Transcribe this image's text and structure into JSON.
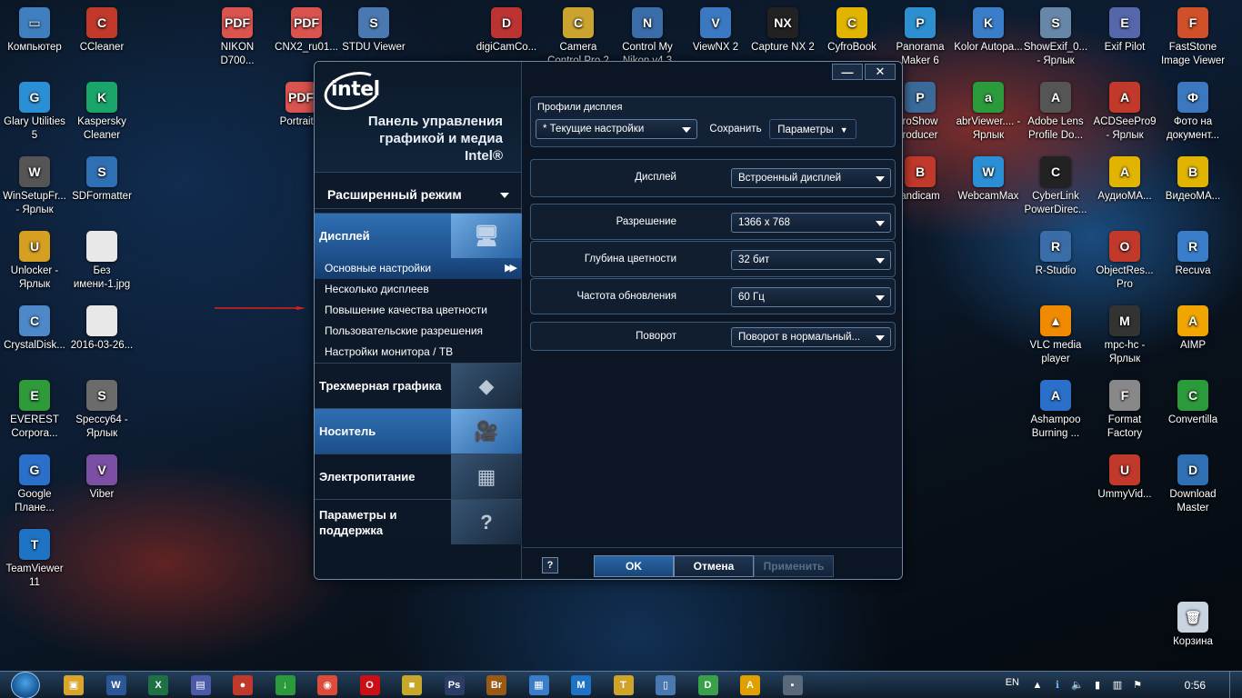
{
  "desktop_icons_left": [
    {
      "label": "Компьютер",
      "color": "#3f7fc0",
      "glyph": "▭"
    },
    {
      "label": "CCleaner",
      "color": "#c0392b",
      "glyph": "C"
    },
    {
      "label": "Glary Utilities 5",
      "color": "#2b8fd6",
      "glyph": "G"
    },
    {
      "label": "Kaspersky Cleaner",
      "color": "#1aa56b",
      "glyph": "K"
    },
    {
      "label": "WinSetupFr... - Ярлык",
      "color": "#555",
      "glyph": "W"
    },
    {
      "label": "SDFormatter",
      "color": "#2f6fb3",
      "glyph": "S"
    },
    {
      "label": "Unlocker - Ярлык",
      "color": "#d5a021",
      "glyph": "U"
    },
    {
      "label": "Без имени-1.jpg",
      "color": "#e8e8e8",
      "glyph": ""
    },
    {
      "label": "CrystalDisk...",
      "color": "#4d88c9",
      "glyph": "C"
    },
    {
      "label": "2016-03-26...",
      "color": "#e8e8e8",
      "glyph": ""
    },
    {
      "label": "EVEREST Corpora...",
      "color": "#2e9a3a",
      "glyph": "E"
    },
    {
      "label": "Speccy64 - Ярлык",
      "color": "#6b6b6b",
      "glyph": "S"
    },
    {
      "label": "Google Плане...",
      "color": "#2a6fc9",
      "glyph": "G"
    },
    {
      "label": "Viber",
      "color": "#7b4fa1",
      "glyph": "V"
    },
    {
      "label": "TeamViewer 11",
      "color": "#1f73c5",
      "glyph": "T"
    }
  ],
  "desktop_icons_top": [
    {
      "label": "NIKON D700...",
      "color": "#d9534f",
      "glyph": "PDF"
    },
    {
      "label": "CNX2_ru01...",
      "color": "#d9534f",
      "glyph": "PDF"
    },
    {
      "label": "STDU Viewer",
      "color": "#4a78b0",
      "glyph": "S"
    },
    {
      "label": "digiCamCo...",
      "color": "#b33",
      "glyph": "D"
    },
    {
      "label": "Camera Control Pro 2",
      "color": "#caa42f",
      "glyph": "C"
    },
    {
      "label": "Control My Nikon v4.3",
      "color": "#3a6da8",
      "glyph": "N"
    },
    {
      "label": "ViewNX 2",
      "color": "#3a79c1",
      "glyph": "V"
    },
    {
      "label": "Capture NX 2",
      "color": "#222",
      "glyph": "NX"
    },
    {
      "label": "CyfroBook",
      "color": "#e0b400",
      "glyph": "C"
    },
    {
      "label": "Panorama Maker 6",
      "color": "#2d8fcf",
      "glyph": "P"
    },
    {
      "label": "Kolor Autopa...",
      "color": "#3a7dc9",
      "glyph": "K"
    },
    {
      "label": "ShowExif_0... - Ярлык",
      "color": "#6787a8",
      "glyph": "S"
    },
    {
      "label": "Exif Pilot",
      "color": "#5566aa",
      "glyph": "E"
    },
    {
      "label": "FastStone Image Viewer",
      "color": "#d0502a",
      "glyph": "F"
    }
  ],
  "desktop_icons_misc": [
    {
      "label": "Portrait...",
      "color": "#d9534f",
      "glyph": "PDF"
    },
    {
      "label": "roShow roducer",
      "color": "#3b6a9a",
      "glyph": "P"
    },
    {
      "label": "abrViewer.... - Ярлык",
      "color": "#2a9a3a",
      "glyph": "a"
    },
    {
      "label": "Adobe Lens Profile Do...",
      "color": "#555",
      "glyph": "A"
    },
    {
      "label": "ACDSeePro9 - Ярлык",
      "color": "#c0392b",
      "glyph": "A"
    },
    {
      "label": "Фото на документ...",
      "color": "#3b78c0",
      "glyph": "Ф"
    },
    {
      "label": "andicam",
      "color": "#c0392b",
      "glyph": "B"
    },
    {
      "label": "WebcamMax",
      "color": "#2b8fd6",
      "glyph": "W"
    },
    {
      "label": "CyberLink PowerDirec...",
      "color": "#222",
      "glyph": "C"
    },
    {
      "label": "АудиоМА...",
      "color": "#e0b400",
      "glyph": "A"
    },
    {
      "label": "ВидеоМА...",
      "color": "#e0b400",
      "glyph": "B"
    },
    {
      "label": "R-Studio",
      "color": "#3a6da8",
      "glyph": "R"
    },
    {
      "label": "ObjectRes... Pro",
      "color": "#c0392b",
      "glyph": "O"
    },
    {
      "label": "Recuva",
      "color": "#3a7dc9",
      "glyph": "R"
    },
    {
      "label": "VLC media player",
      "color": "#f08a00",
      "glyph": "▲"
    },
    {
      "label": "mpc-hc - Ярлык",
      "color": "#333",
      "glyph": "M"
    },
    {
      "label": "AIMP",
      "color": "#f0a500",
      "glyph": "A"
    },
    {
      "label": "Ashampoo Burning ...",
      "color": "#2a6fc9",
      "glyph": "A"
    },
    {
      "label": "Format Factory",
      "color": "#888",
      "glyph": "F"
    },
    {
      "label": "Convertilla",
      "color": "#2a9a3a",
      "glyph": "C"
    },
    {
      "label": "UmmyVid...",
      "color": "#c0392b",
      "glyph": "U"
    },
    {
      "label": "Download Master",
      "color": "#2f6fb3",
      "glyph": "D"
    },
    {
      "label": "Корзина",
      "color": "#c8d4df",
      "glyph": "🗑"
    }
  ],
  "window": {
    "logo_text": "intel",
    "title_line1": "Панель управления",
    "title_line2": "графикой и медиа",
    "title_line3": "Intel®",
    "minimize": "—",
    "close": "✕",
    "mode": "Расширенный режим",
    "nav": {
      "display": "Дисплей",
      "graphics3d": "Трехмерная графика",
      "media": "Носитель",
      "power": "Электропитание",
      "options": "Параметры и поддержка"
    },
    "sub_items": [
      "Основные настройки",
      "Несколько дисплеев",
      "Повышение качества цветности",
      "Пользовательские разрешения",
      "Настройки монитора / ТВ"
    ],
    "profiles_title": "Профили дисплея",
    "profile_value": "* Текущие настройки",
    "save": "Сохранить",
    "params": "Параметры",
    "settings": {
      "display_label": "Дисплей",
      "display_value": "Встроенный дисплей",
      "resolution_label": "Разрешение",
      "resolution_value": "1366 x 768",
      "depth_label": "Глубина цветности",
      "depth_value": "32 бит",
      "refresh_label": "Частота обновления",
      "refresh_value": "60 Гц",
      "rotation_label": "Поворот",
      "rotation_value": "Поворот в нормальный..."
    },
    "help": "?",
    "ok": "OK",
    "cancel": "Отмена",
    "apply": "Применить"
  },
  "taskbar": {
    "items": [
      {
        "glyph": "▣",
        "color": "#d9a52b"
      },
      {
        "glyph": "W",
        "color": "#2b5797"
      },
      {
        "glyph": "X",
        "color": "#1e7145"
      },
      {
        "glyph": "▤",
        "color": "#4a5aa8"
      },
      {
        "glyph": "●",
        "color": "#c0392b"
      },
      {
        "glyph": "↓",
        "color": "#2a9a3a"
      },
      {
        "glyph": "◉",
        "color": "#dd4b39"
      },
      {
        "glyph": "O",
        "color": "#cc0f16"
      },
      {
        "glyph": "■",
        "color": "#c8a82a"
      },
      {
        "glyph": "Ps",
        "color": "#2b3d66"
      },
      {
        "glyph": "Br",
        "color": "#9a5a14"
      },
      {
        "glyph": "▦",
        "color": "#3a7dc9"
      },
      {
        "glyph": "M",
        "color": "#1f73c5"
      },
      {
        "glyph": "T",
        "color": "#d0a32b"
      },
      {
        "glyph": "▯",
        "color": "#4a78b0"
      },
      {
        "glyph": "D",
        "color": "#3aa04a"
      },
      {
        "glyph": "A",
        "color": "#e0a000"
      },
      {
        "glyph": "▪",
        "color": "#5a6a7a"
      }
    ],
    "lang": "EN",
    "clock": "0:56"
  }
}
